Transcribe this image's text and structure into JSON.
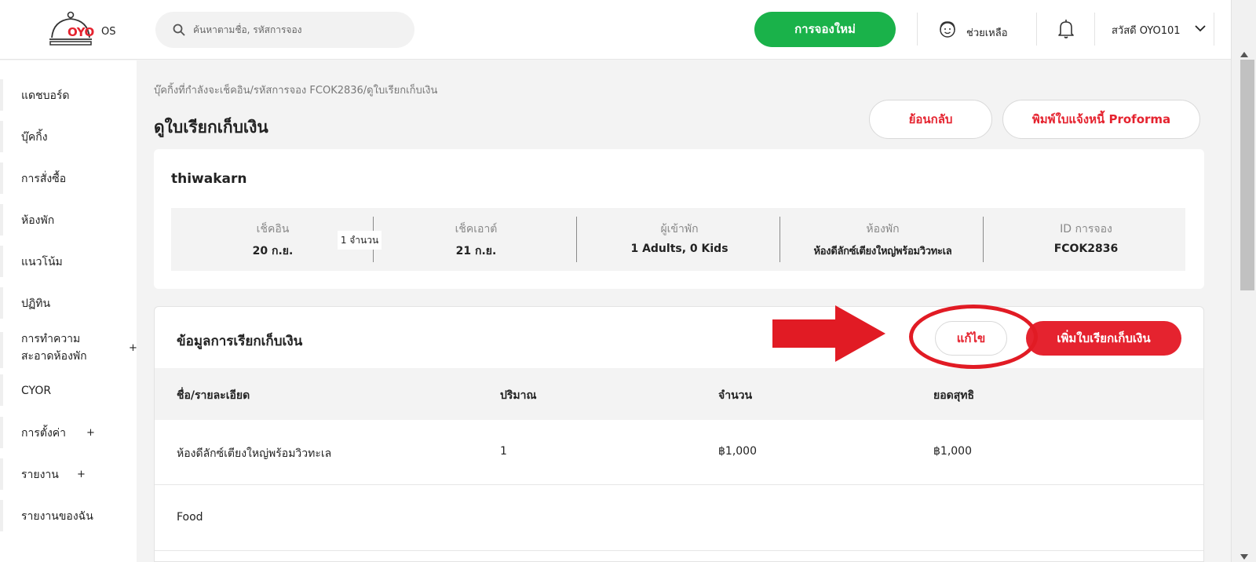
{
  "header": {
    "logo_text": "OYO",
    "logo_suffix": "OS",
    "search_placeholder": "ค้นหาตามชื่อ, รหัสการจอง",
    "new_booking_label": "การจองใหม่",
    "help_label": "ช่วยเหลือ",
    "user_greeting": "สวัสดี OYO101"
  },
  "sidebar": {
    "items": [
      {
        "label": "แดชบอร์ด"
      },
      {
        "label": "บุ๊คกิ้ง"
      },
      {
        "label": "การสั่งซื้อ"
      },
      {
        "label": "ห้องพัก"
      },
      {
        "label": "แนวโน้ม"
      },
      {
        "label": "ปฏิทิน"
      },
      {
        "label": "การทำความ สะอาดห้องพัก",
        "expand": "+"
      },
      {
        "label": "CYOR"
      },
      {
        "label": "การตั้งค่า",
        "expand": "+"
      },
      {
        "label": "รายงาน",
        "expand": "+"
      },
      {
        "label": "รายงานของฉัน"
      }
    ]
  },
  "main": {
    "breadcrumb": "บุ๊คกิ้งที่กำลังจะเช็คอิน/รหัสการจอง FCOK2836/ดูใบเรียกเก็บเงิน",
    "title": "ดูใบเรียกเก็บเงิน",
    "back_label": "ย้อนกลับ",
    "print_label": "พิมพ์ใบแจ้งหนี้ Proforma"
  },
  "booking": {
    "guest_name": "thiwakarn",
    "nights_tooltip": "1 จำนวน",
    "fields": [
      {
        "label": "เช็คอิน",
        "value": "20 ก.ย."
      },
      {
        "label": "เช็คเอาต์",
        "value": "21 ก.ย."
      },
      {
        "label": "ผู้เข้าพัก",
        "value": "1 Adults, 0 Kids"
      },
      {
        "label": "ห้องพัก",
        "value": "ห้องดีลักซ์เตียงใหญ่พร้อมวิวทะเล"
      },
      {
        "label": "ID การจอง",
        "value": "FCOK2836"
      }
    ]
  },
  "billing": {
    "title": "ข้อมูลการเรียกเก็บเงิน",
    "edit_label": "แก้ไข",
    "add_label": "เพิ่มใบเรียกเก็บเงิน",
    "columns": [
      "ชื่อ/รายละเอียด",
      "ปริมาณ",
      "จำนวน",
      "ยอดสุทธิ"
    ],
    "rows": [
      [
        "ห้องดีลักซ์เตียงใหญ่พร้อมวิวทะเล",
        "1",
        "฿1,000",
        "฿1,000"
      ],
      [
        "Food",
        "",
        "",
        ""
      ]
    ]
  },
  "colors": {
    "brand_red": "#e5232f",
    "primary_green": "#1ab24a",
    "annotation_red": "#e11b24"
  }
}
